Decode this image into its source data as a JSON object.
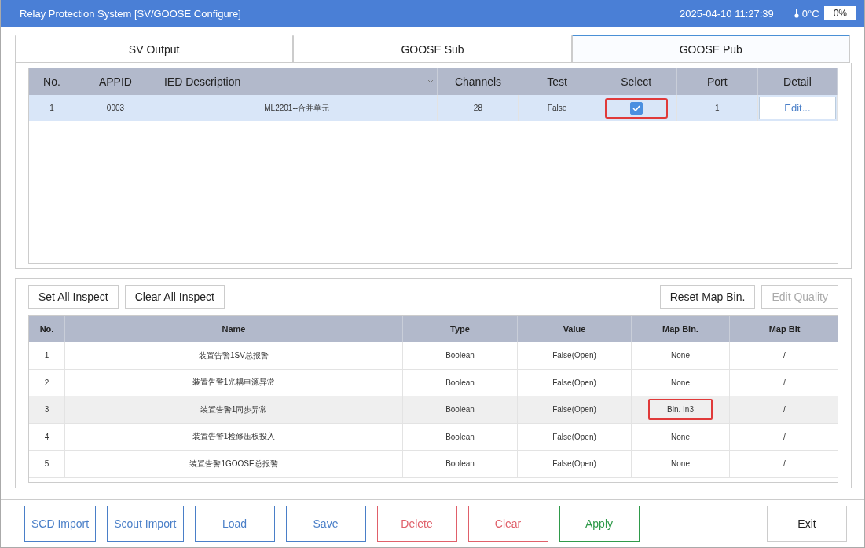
{
  "window": {
    "title": "Relay Protection System [SV/GOOSE Configure]",
    "datetime": "2025-04-10 11:27:39",
    "temperature": "0°C",
    "percent": "0%"
  },
  "tabs": [
    {
      "label": "SV Output",
      "selected": false
    },
    {
      "label": "GOOSE Sub",
      "selected": false
    },
    {
      "label": "GOOSE Pub",
      "selected": true
    }
  ],
  "ied_table": {
    "columns": [
      "No.",
      "APPID",
      "IED Description",
      "Channels",
      "Test",
      "Select",
      "Port",
      "Detail"
    ],
    "rows": [
      {
        "no": "1",
        "appid": "0003",
        "description": "ML2201--合并单元",
        "channels": "28",
        "test": "False",
        "checked": true,
        "highlighted": true,
        "port": "1",
        "detail": "Edit...",
        "selected": true
      }
    ]
  },
  "toolbar": {
    "left": [
      {
        "label": "Set All Inspect",
        "disabled": false
      },
      {
        "label": "Clear All Inspect",
        "disabled": false
      }
    ],
    "right": [
      {
        "label": "Reset Map Bin.",
        "disabled": false
      },
      {
        "label": "Edit Quality",
        "disabled": true
      }
    ]
  },
  "channel_table": {
    "columns": [
      "No.",
      "Name",
      "Type",
      "Value",
      "Map Bin.",
      "Map Bit"
    ],
    "rows": [
      {
        "no": "1",
        "name": "装置告警1SV总报警",
        "type": "Boolean",
        "value": "False(Open)",
        "map_bin": "None",
        "map_bit": "/",
        "selected": false,
        "highlighted": false
      },
      {
        "no": "2",
        "name": "装置告警1光耦电源异常",
        "type": "Boolean",
        "value": "False(Open)",
        "map_bin": "None",
        "map_bit": "/",
        "selected": false,
        "highlighted": false
      },
      {
        "no": "3",
        "name": "装置告警1同步异常",
        "type": "Boolean",
        "value": "False(Open)",
        "map_bin": "Bin. In3",
        "map_bit": "/",
        "selected": true,
        "highlighted": true
      },
      {
        "no": "4",
        "name": "装置告警1检修压板投入",
        "type": "Boolean",
        "value": "False(Open)",
        "map_bin": "None",
        "map_bit": "/",
        "selected": false,
        "highlighted": false
      },
      {
        "no": "5",
        "name": "装置告警1GOOSE总报警",
        "type": "Boolean",
        "value": "False(Open)",
        "map_bin": "None",
        "map_bit": "/",
        "selected": false,
        "highlighted": false
      }
    ]
  },
  "buttons": [
    {
      "label": "SCD Import",
      "color": "#4a7fc8"
    },
    {
      "label": "Scout Import",
      "color": "#4a7fc8"
    },
    {
      "label": "Load",
      "color": "#4a7fc8"
    },
    {
      "label": "Save",
      "color": "#4a7fc8"
    },
    {
      "label": "Delete",
      "color": "#e0606a"
    },
    {
      "label": "Clear",
      "color": "#e0606a"
    },
    {
      "label": "Apply",
      "color": "#2f9a4a"
    }
  ],
  "exit_button": {
    "label": "Exit"
  }
}
